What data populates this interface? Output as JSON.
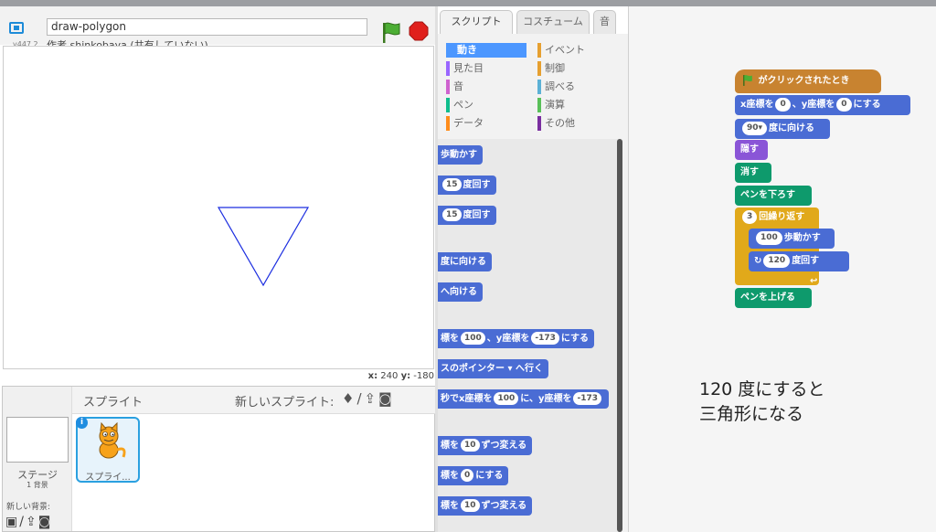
{
  "project": {
    "title": "draw-polygon",
    "version": "v447.2",
    "author": "作者 shinkobaya (共有していない)"
  },
  "stage": {
    "coords_x_label": "x:",
    "coords_x": "240",
    "coords_y_label": "y:",
    "coords_y": "-180"
  },
  "sprites": {
    "header": "スプライト",
    "new_sprite": "新しいスプライト:",
    "stage_label": "ステージ",
    "backdrop_count": "1 背景",
    "new_backdrop": "新しい背景:",
    "sprite_name": "スプライ..."
  },
  "tabs": {
    "script": "スクリプト",
    "costume": "コスチューム",
    "sound": "音"
  },
  "categories": {
    "left": [
      "動き",
      "見た目",
      "音",
      "ペン",
      "データ"
    ],
    "right": [
      "イベント",
      "制御",
      "調べる",
      "演算",
      "その他"
    ],
    "colors_left": [
      "#4c97ff",
      "#9966ff",
      "#cf63cf",
      "#0fbd8c",
      "#ff8c1a"
    ],
    "colors_right": [
      "#e6a030",
      "#e6a030",
      "#5cb1d6",
      "#59c059",
      "#7a2ea0"
    ]
  },
  "palette": {
    "b1": "歩動かす",
    "b2_num": "15",
    "b2": "度回す",
    "b3_num": "15",
    "b3": "度回す",
    "b4": "度に向ける",
    "b5": "へ向ける",
    "b6_a": "標を",
    "b6_num1": "100",
    "b6_b": "、y座標を",
    "b6_num2": "-173",
    "b6_c": "にする",
    "b7": "スのポインター ▾ へ行く",
    "b8_a": "秒でx座標を",
    "b8_num1": "100",
    "b8_b": "に、y座標を",
    "b8_num2": "-173",
    "b9_a": "標を",
    "b9_num": "10",
    "b9_b": "ずつ変える",
    "b10_a": "標を",
    "b10_num": "0",
    "b10_b": "にする",
    "b11_a": "標を",
    "b11_num": "10",
    "b11_b": "ずつ変える"
  },
  "script": {
    "hat": "がクリックされたとき",
    "goto_a": "x座標を",
    "goto_x": "0",
    "goto_b": "、y座標を",
    "goto_y": "0",
    "goto_c": "にする",
    "point_num": "90▾",
    "point": "度に向ける",
    "hide": "隠す",
    "clear": "消す",
    "pen_down": "ペンを下ろす",
    "repeat_num": "3",
    "repeat": "回繰り返す",
    "move_num": "100",
    "move": "歩動かす",
    "turn_num": "120",
    "turn": "度回す",
    "pen_up": "ペンを上げる"
  },
  "note": {
    "line1": "120 度にすると",
    "line2": "三角形になる"
  }
}
